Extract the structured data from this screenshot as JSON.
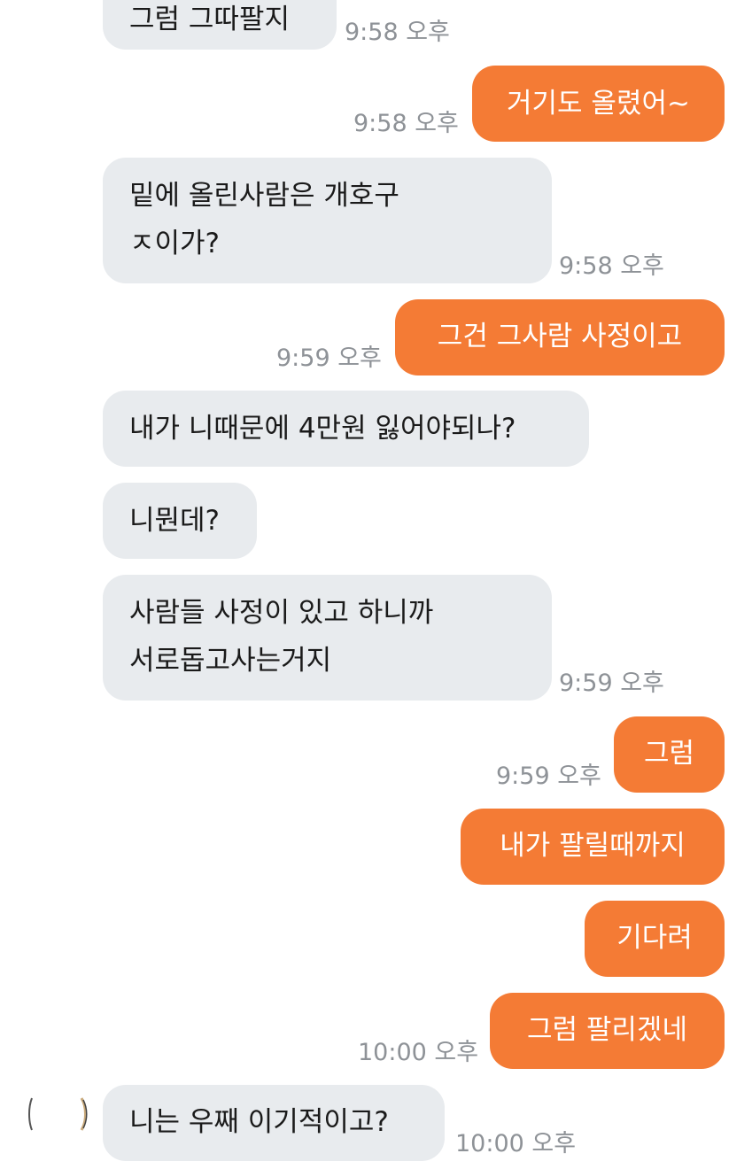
{
  "messages": [
    {
      "id": "m1",
      "side": "in",
      "lines": [
        "그럼 그따팔지"
      ],
      "time": "9:58 오후"
    },
    {
      "id": "m2",
      "side": "out",
      "lines": [
        "거기도 올렸어~"
      ],
      "time": "9:58 오후"
    },
    {
      "id": "m3",
      "side": "in",
      "lines": [
        "밑에 올린사람은 개호구",
        "ㅈ이가?"
      ],
      "time": "9:58 오후"
    },
    {
      "id": "m4",
      "side": "out",
      "lines": [
        "그건 그사람 사정이고"
      ],
      "time": "9:59 오후"
    },
    {
      "id": "m5",
      "side": "in",
      "lines": [
        "내가 니때문에 4만원 잃어야되나?"
      ],
      "time": ""
    },
    {
      "id": "m6",
      "side": "in",
      "lines": [
        "니뭔데?"
      ],
      "time": ""
    },
    {
      "id": "m7",
      "side": "in",
      "lines": [
        "사람들 사정이 있고 하니까",
        "서로돕고사는거지"
      ],
      "time": "9:59 오후"
    },
    {
      "id": "m8",
      "side": "out",
      "lines": [
        "그럼"
      ],
      "time": "9:59 오후"
    },
    {
      "id": "m9",
      "side": "out",
      "lines": [
        "내가 팔릴때까지"
      ],
      "time": ""
    },
    {
      "id": "m10",
      "side": "out",
      "lines": [
        "기다려"
      ],
      "time": ""
    },
    {
      "id": "m11",
      "side": "out",
      "lines": [
        "그럼 팔리겠네"
      ],
      "time": "10:00 오후"
    },
    {
      "id": "m12",
      "side": "in",
      "lines": [
        "니는 우째 이기적이고?"
      ],
      "time": "10:00 오후"
    }
  ],
  "colors": {
    "incoming_bubble": "#e8ebee",
    "outgoing_bubble": "#f47b35",
    "timestamp": "#8e9297"
  },
  "icons": {
    "avatar": "sender-avatar-icon"
  }
}
